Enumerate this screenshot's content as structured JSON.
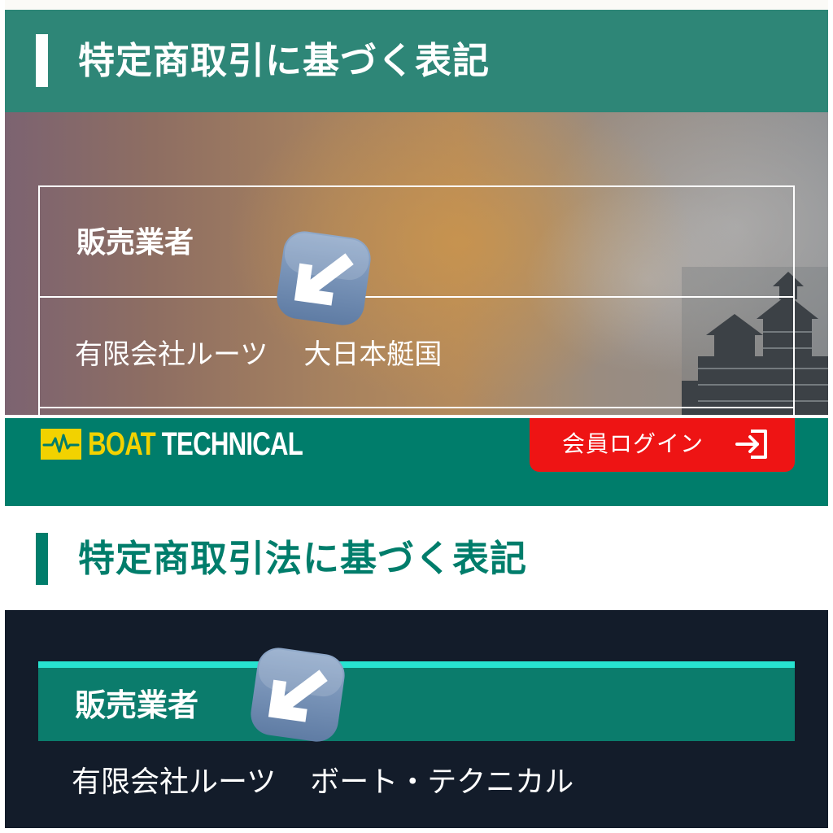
{
  "top": {
    "title": "特定商取引に基づく表記",
    "table": {
      "seller_label": "販売業者",
      "seller_company": "有限会社ルーツ",
      "seller_brand": "大日本艇国"
    }
  },
  "bottom": {
    "logo": {
      "word1": "BOAT",
      "word2": "TECHNICAL"
    },
    "login": {
      "label": "会員ログイン"
    },
    "title": "特定商取引法に基づく表記",
    "table": {
      "seller_label": "販売業者",
      "seller_company": "有限会社ルーツ",
      "seller_brand": "ボート・テクニカル"
    }
  },
  "icons": {
    "arrow": "down-left-arrow-emoji-icon",
    "login": "login-arrow-icon",
    "logo": "heartbeat-logo-icon"
  },
  "colors": {
    "top_header": "#2e8677",
    "bottom_header": "#007d6b",
    "login_button": "#ee1414",
    "logo_yellow": "#f2d200",
    "dark_bg": "#131c2a",
    "row_accent": "#27e3d0"
  }
}
